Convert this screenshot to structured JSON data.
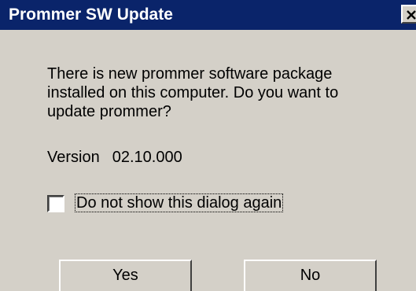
{
  "window": {
    "title": "Prommer SW Update",
    "close_icon": "close-icon"
  },
  "message": {
    "lines": [
      "There is new prommer software package",
      "installed on this computer. Do you want to",
      "update prommer?"
    ]
  },
  "version": {
    "label": "Version",
    "value": "02.10.000"
  },
  "checkbox": {
    "label": "Do not show this dialog again",
    "checked": false
  },
  "buttons": {
    "yes": "Yes",
    "no": "No"
  },
  "colors": {
    "titlebar": "#0a246a",
    "face": "#d4d0c8"
  }
}
